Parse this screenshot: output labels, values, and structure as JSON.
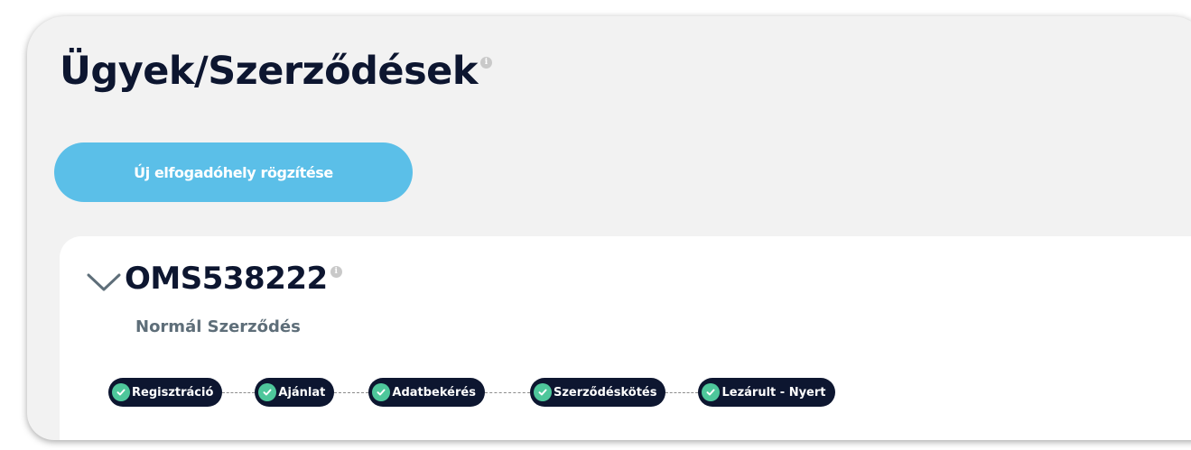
{
  "page": {
    "title": "Ügyek/Szerződések",
    "info_icon_glyph": "i"
  },
  "actions": {
    "new_place_label": "Új elfogadóhely rögzítése"
  },
  "contract": {
    "id": "OMS538222",
    "type": "Normál Szerződés",
    "expand_icon": "chevron-down-icon",
    "steps": [
      {
        "label": "Regisztráció",
        "status": "completed",
        "icon": "check-circle-icon"
      },
      {
        "label": "Ajánlat",
        "status": "completed",
        "icon": "check-circle-icon"
      },
      {
        "label": "Adatbekérés",
        "status": "completed",
        "icon": "check-circle-icon"
      },
      {
        "label": "Szerződéskötés",
        "status": "completed",
        "icon": "check-circle-icon"
      },
      {
        "label": "Lezárult - Nyert",
        "status": "completed",
        "icon": "check-circle-icon"
      }
    ]
  },
  "colors": {
    "title": "#0d1630",
    "primary_button": "#5bbfe8",
    "step_pill": "#0d1630",
    "check": "#4ec79b",
    "subtitle": "#5e6e79",
    "panel_bg": "#f2f2f2"
  }
}
